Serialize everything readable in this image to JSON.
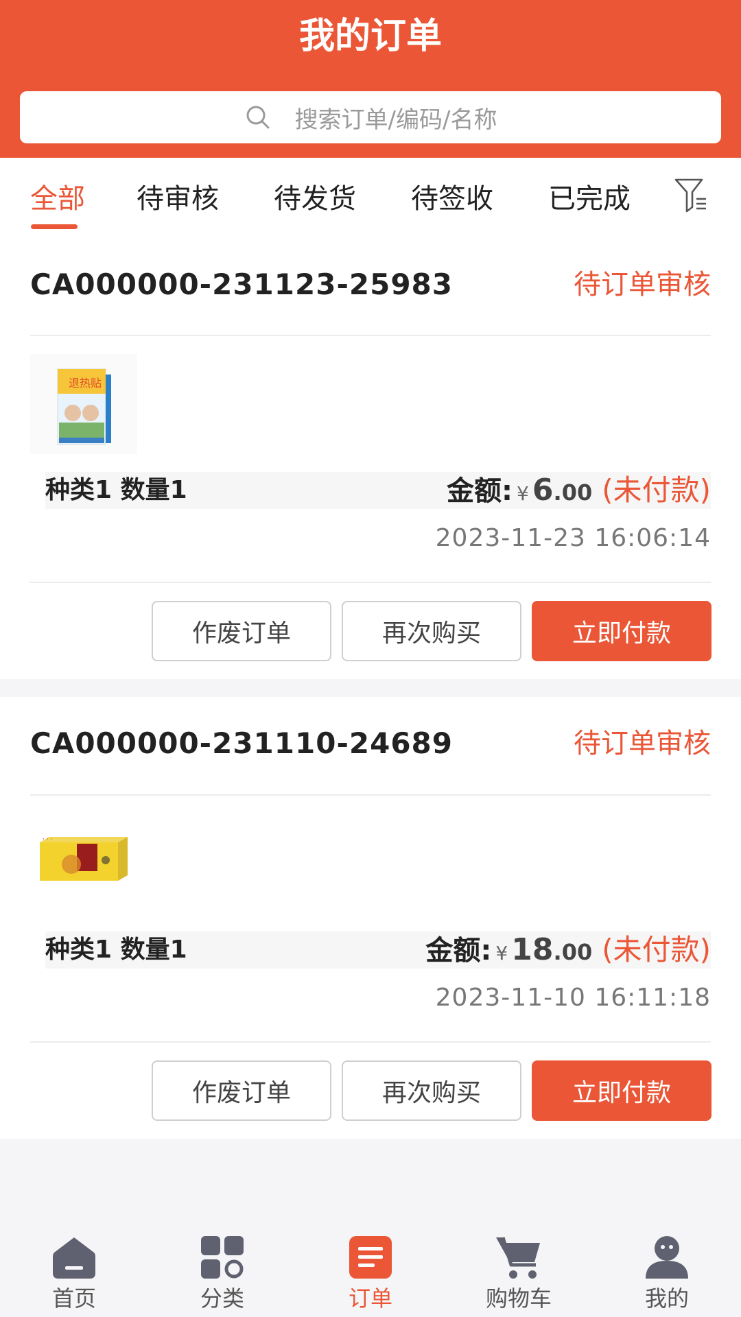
{
  "header": {
    "title": "我的订单"
  },
  "search": {
    "placeholder": "搜索订单/编码/名称"
  },
  "tabs": [
    {
      "label": "全部",
      "active": true
    },
    {
      "label": "待审核",
      "active": false
    },
    {
      "label": "待发货",
      "active": false
    },
    {
      "label": "待签收",
      "active": false
    },
    {
      "label": "已完成",
      "active": false
    }
  ],
  "filter_icon": "filter-icon",
  "orders": [
    {
      "order_no": "CA000000-231123-25983",
      "status": "待订单审核",
      "product_image": "cooling-patch-box",
      "summary": "种类1 数量1",
      "amount_label": "金额:",
      "currency": "¥",
      "amount_int": "6",
      "amount_dec": ".00",
      "payment_status": "(未付款)",
      "time": "2023-11-23 16:06:14",
      "buttons": {
        "void": "作废订单",
        "rebuy": "再次购买",
        "pay": "立即付款"
      }
    },
    {
      "order_no": "CA000000-231110-24689",
      "status": "待订单审核",
      "product_image": "yellow-gift-box",
      "summary": "种类1 数量1",
      "amount_label": "金额:",
      "currency": "¥",
      "amount_int": "18",
      "amount_dec": ".00",
      "payment_status": "(未付款)",
      "time": "2023-11-10 16:11:18",
      "buttons": {
        "void": "作废订单",
        "rebuy": "再次购买",
        "pay": "立即付款"
      }
    }
  ],
  "bottom_nav": [
    {
      "label": "首页",
      "icon": "home-icon",
      "active": false
    },
    {
      "label": "分类",
      "icon": "category-icon",
      "active": false
    },
    {
      "label": "订单",
      "icon": "order-icon",
      "active": true
    },
    {
      "label": "购物车",
      "icon": "cart-icon",
      "active": false
    },
    {
      "label": "我的",
      "icon": "profile-icon",
      "active": false
    }
  ],
  "colors": {
    "accent": "#ea5636",
    "background": "#f5f5f7",
    "nav_icon": "#5f6170"
  }
}
